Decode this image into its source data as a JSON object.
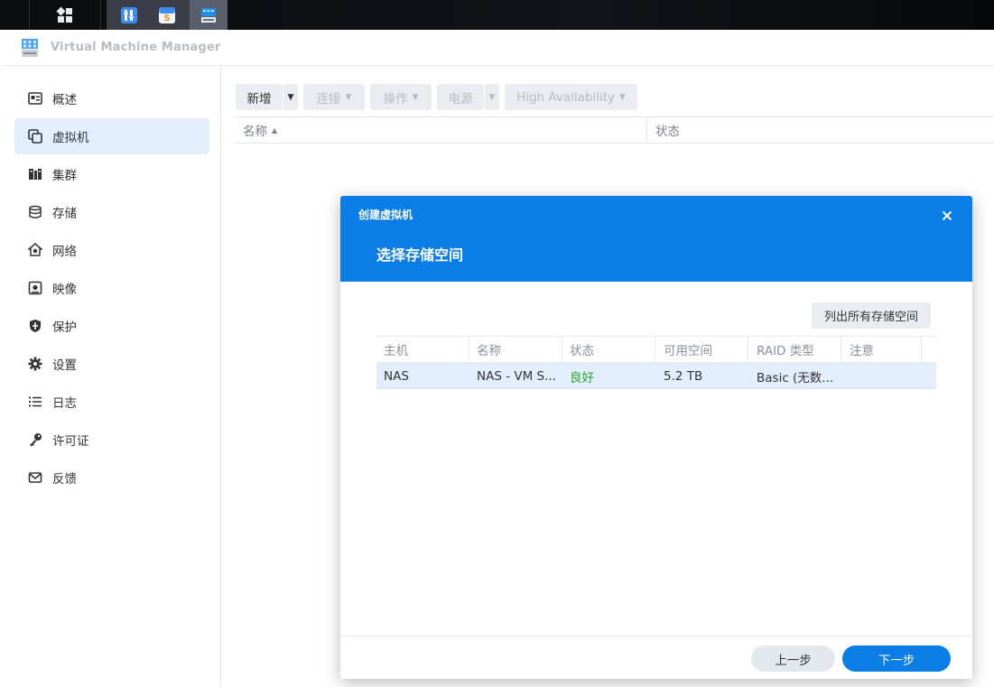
{
  "window": {
    "title": "Virtual Machine Manager"
  },
  "taskbar": {
    "apps": [
      "main-menu-icon",
      "control-panel-icon",
      "package-center-icon",
      "virtual-machine-manager-icon"
    ]
  },
  "sidebar": {
    "items": [
      {
        "label": "概述",
        "icon": "overview-icon"
      },
      {
        "label": "虚拟机",
        "icon": "virtual-machine-icon"
      },
      {
        "label": "集群",
        "icon": "cluster-icon"
      },
      {
        "label": "存储",
        "icon": "storage-icon"
      },
      {
        "label": "网络",
        "icon": "network-icon"
      },
      {
        "label": "映像",
        "icon": "image-icon"
      },
      {
        "label": "保护",
        "icon": "shield-icon"
      },
      {
        "label": "设置",
        "icon": "gear-icon"
      },
      {
        "label": "日志",
        "icon": "log-icon"
      },
      {
        "label": "许可证",
        "icon": "key-icon"
      },
      {
        "label": "反馈",
        "icon": "mail-icon"
      }
    ],
    "active_index": 1
  },
  "toolbar": {
    "create": "新增",
    "connect": "连接",
    "action": "操作",
    "power": "电源",
    "ha": "High Availability"
  },
  "vm_list": {
    "columns": [
      "名称",
      "状态"
    ],
    "sort_indicator": "▲"
  },
  "dialog": {
    "caption": "创建虚拟机",
    "heading": "选择存储空间",
    "list_all_button": "列出所有存储空间",
    "columns": [
      "主机",
      "名称",
      "状态",
      "可用空间",
      "RAID 类型",
      "注意"
    ],
    "rows": [
      {
        "host": "NAS",
        "name": "NAS - VM S...",
        "status": "良好",
        "free": "5.2 TB",
        "raid": "Basic (无数...",
        "note": ""
      }
    ],
    "prev_button": "上一步",
    "next_button": "下一步"
  },
  "colors": {
    "accent": "#0a7de6",
    "good": "#2aa32a",
    "active_bg": "#e3eefc"
  }
}
